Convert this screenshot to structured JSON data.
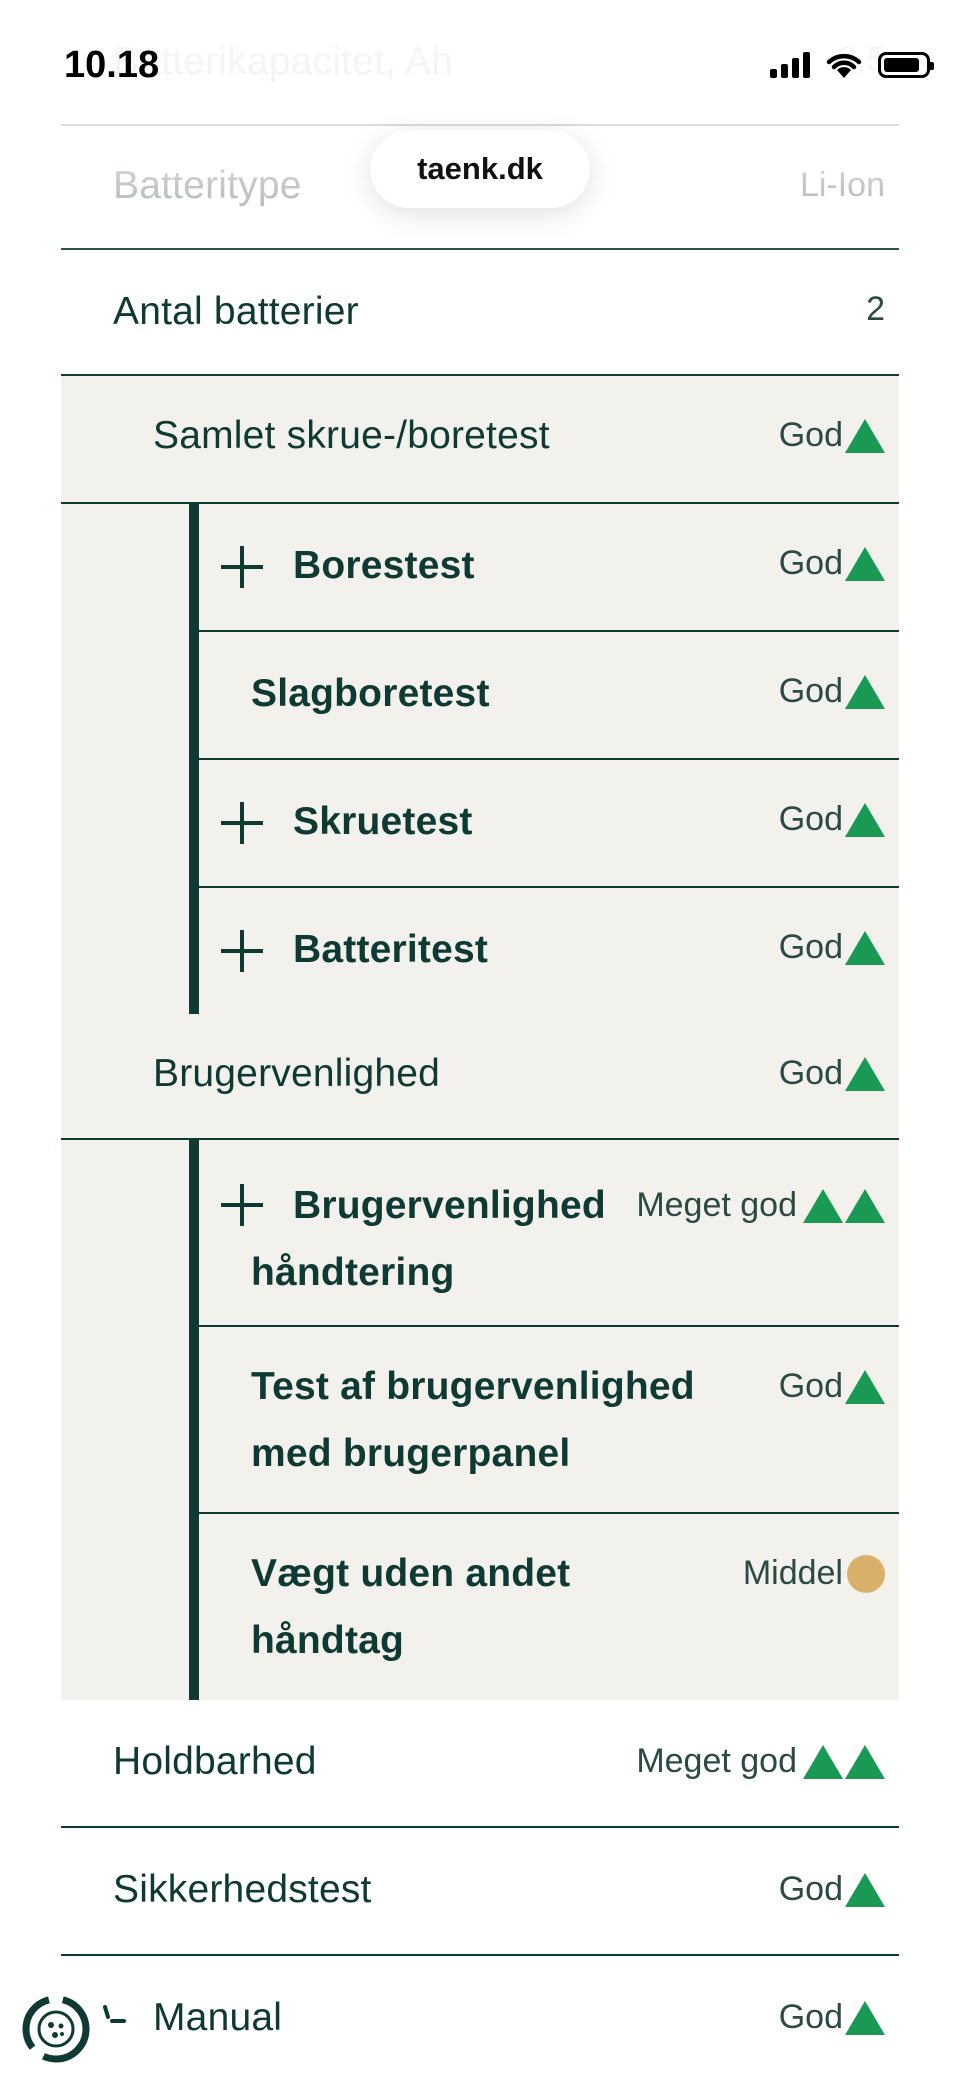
{
  "status_bar": {
    "time": "10.18"
  },
  "browser": {
    "url": "taenk.dk"
  },
  "rows": {
    "battery_capacity": {
      "label": "Batterikapacitet, Ah",
      "value": "2,5"
    },
    "battery_type": {
      "label": "Batteritype",
      "value": "Li-Ion"
    },
    "battery_count": {
      "label": "Antal batterier",
      "value": "2"
    },
    "screw_drill_total": {
      "label": "Samlet skrue-/boretest",
      "value": "God"
    },
    "drill_test": {
      "label": "Borestest",
      "value": "God"
    },
    "impact_drill_test": {
      "label": "Slagboretest",
      "value": "God"
    },
    "screw_test": {
      "label": "Skruetest",
      "value": "God"
    },
    "battery_test": {
      "label": "Batteritest",
      "value": "God"
    },
    "usability": {
      "label": "Brugervenlighed",
      "value": "God"
    },
    "usability_handling": {
      "label_line1": "Brugervenlighed",
      "label_line2": "håndtering",
      "value": "Meget god"
    },
    "usability_panel": {
      "label_line1": "Test af brugervenlighed",
      "label_line2": "med brugerpanel",
      "value": "God"
    },
    "weight": {
      "label_line1": "Vægt uden andet",
      "label_line2": "håndtag",
      "value": "Middel"
    },
    "durability": {
      "label": "Holdbarhed",
      "value": "Meget god"
    },
    "safety_test": {
      "label": "Sikkerhedstest",
      "value": "God"
    },
    "manual": {
      "label": "Manual",
      "value": "God"
    }
  },
  "colors": {
    "text_dark_green": "#0f3a33",
    "rating_green": "#1a9955",
    "rating_neutral": "#d9b06a",
    "panel_background": "#f3f1ec"
  },
  "icons": {
    "expand": "plus-icon",
    "rating_good": "green-triangle-icon",
    "rating_neutral": "yellow-dot-icon",
    "cookie_settings": "cookie-settings-icon"
  }
}
